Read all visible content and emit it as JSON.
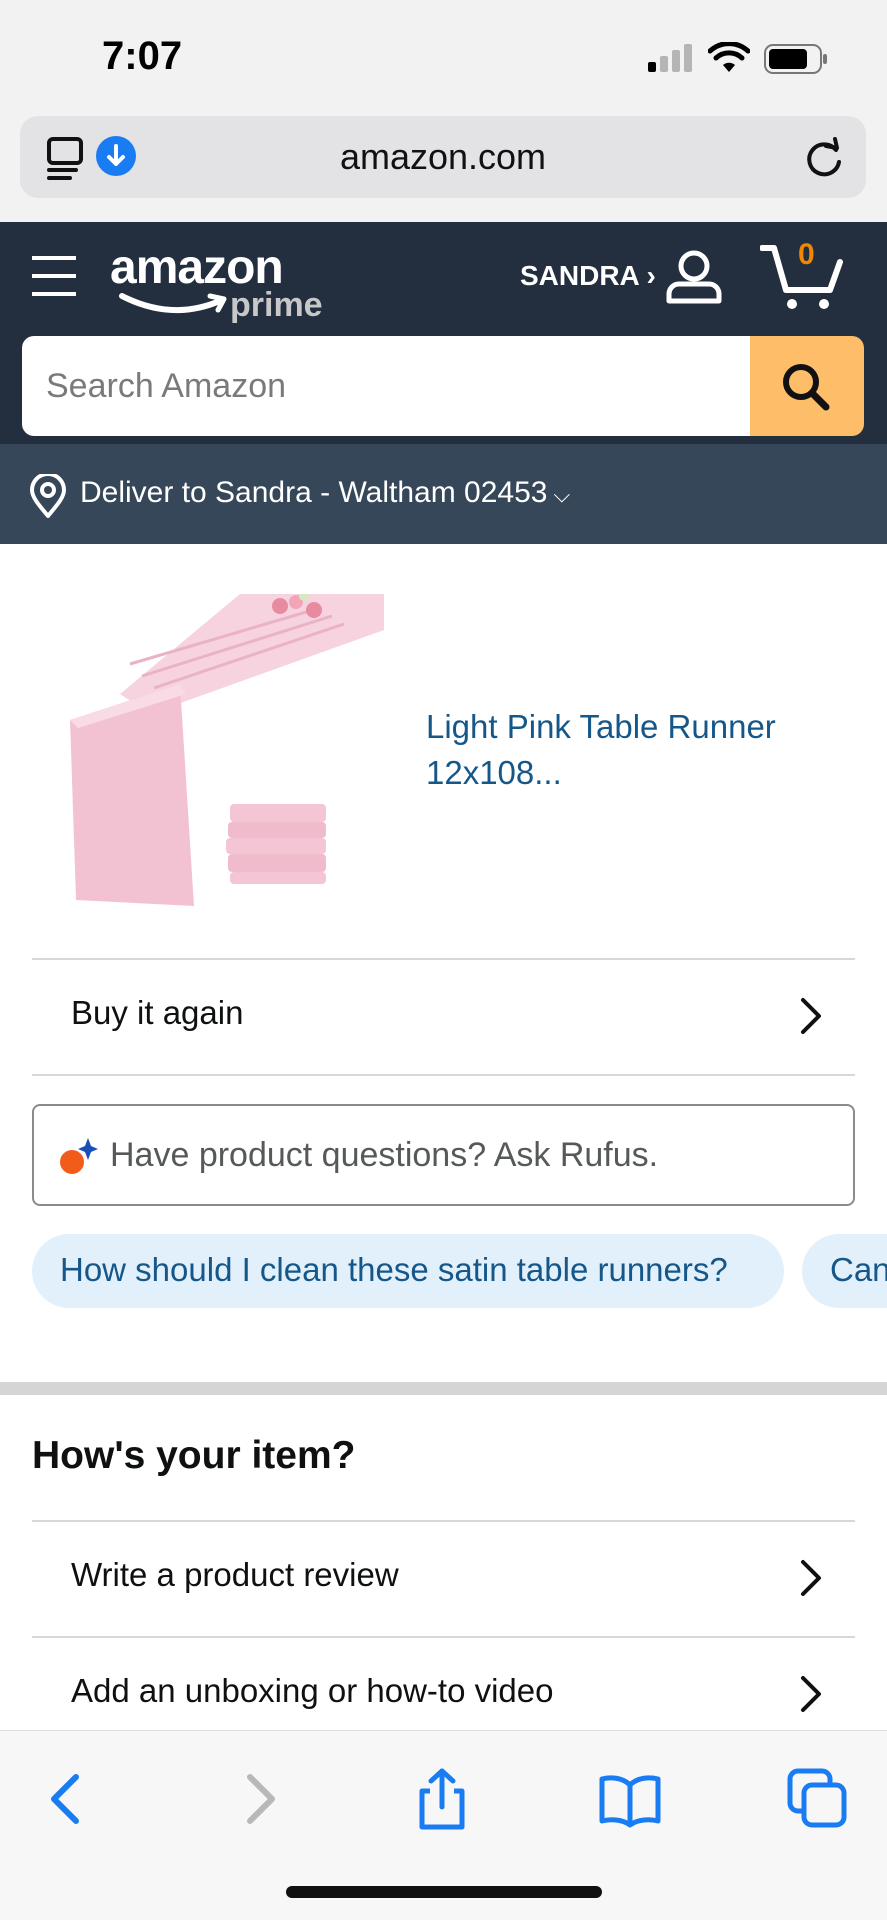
{
  "status_bar": {
    "time": "7:07"
  },
  "browser": {
    "url": "amazon.com"
  },
  "header": {
    "logo_text": "amazon",
    "logo_subtext": "prime",
    "user_name": "SANDRA ›",
    "cart_count": "0"
  },
  "search": {
    "placeholder": "Search Amazon"
  },
  "delivery": {
    "text": "Deliver to Sandra - Waltham 02453",
    "chevron": "⌵"
  },
  "product": {
    "title": "Light Pink Table Runner 12x108..."
  },
  "buy_again": {
    "label": "Buy it again"
  },
  "rufus": {
    "prompt": "Have product questions? Ask Rufus.",
    "chips": [
      "How should I clean these satin table runners?",
      "Can"
    ]
  },
  "review_section": {
    "title": "How's your item?",
    "items": [
      "Write a product review",
      "Add an unboxing or how-to video"
    ]
  },
  "colors": {
    "header_bg": "#232f3e",
    "deliver_bg": "#37475a",
    "search_button": "#febd69",
    "link": "#16578a",
    "cart_badge": "#f08804",
    "safari_blue": "#1a7cf3"
  },
  "icons": {
    "status": [
      "cellular-signal-icon",
      "wifi-icon",
      "battery-icon"
    ],
    "browser": [
      "reader-mode-icon",
      "download-icon",
      "reload-icon"
    ],
    "header": [
      "menu-icon",
      "account-icon",
      "cart-icon",
      "search-icon"
    ],
    "toolbar": [
      "back-icon",
      "forward-icon",
      "share-icon",
      "bookmarks-icon",
      "tabs-icon"
    ]
  }
}
